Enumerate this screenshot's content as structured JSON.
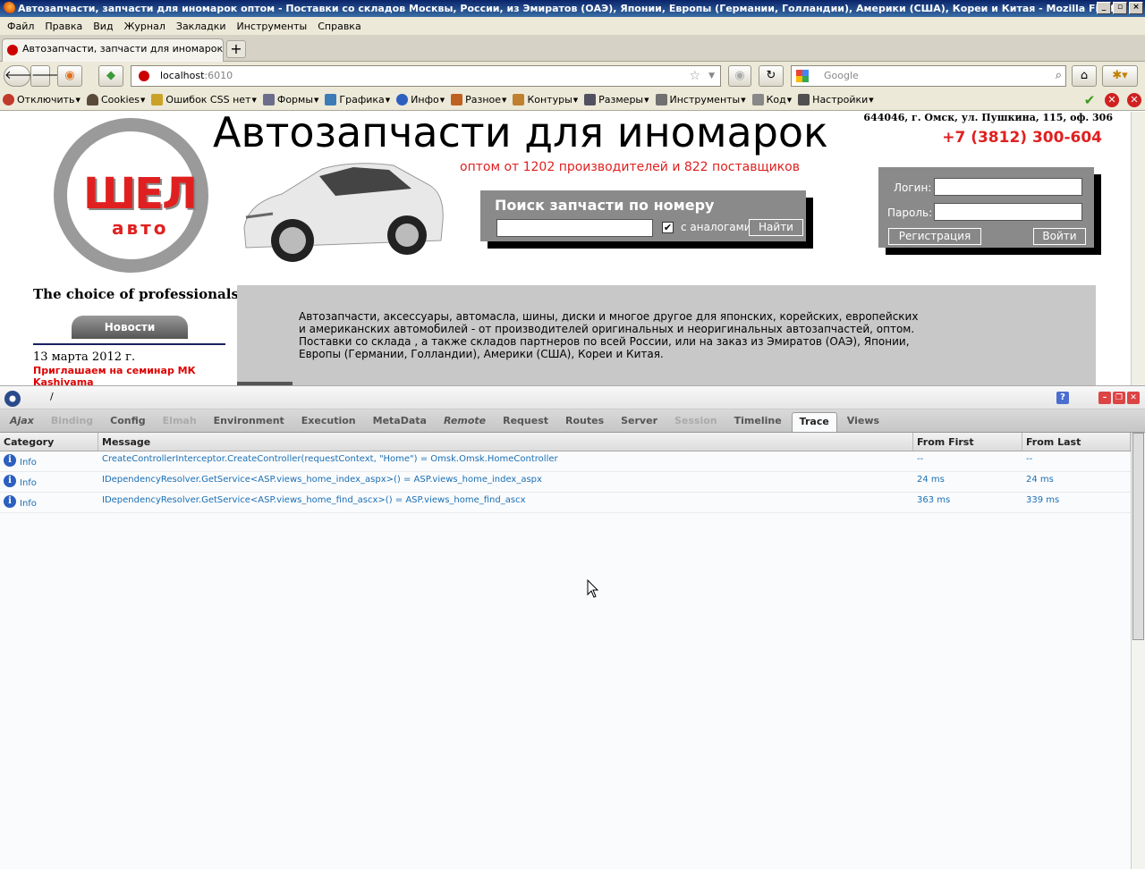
{
  "window": {
    "title": "Автозапчасти, запчасти для иномарок оптом - Поставки со складов Москвы, России, из Эмиратов (ОАЭ), Японии, Европы (Германии, Голландии), Америки (США), Кореи и Китая - Mozilla Firefox"
  },
  "menu": [
    "Файл",
    "Правка",
    "Вид",
    "Журнал",
    "Закладки",
    "Инструменты",
    "Справка"
  ],
  "tab": {
    "title": "Автозапчасти, запчасти для иномарок оп..."
  },
  "address": {
    "host": "localhost",
    "port": ":6010"
  },
  "search": {
    "placeholder": "Google"
  },
  "devtoolbar": [
    {
      "label": "Отключить",
      "icon": "disable-icon",
      "color": "#c0392b"
    },
    {
      "label": "Cookies",
      "icon": "cookies-icon",
      "color": "#5a4a3a"
    },
    {
      "label": "Ошибок CSS нет",
      "icon": "css-icon",
      "color": "#c9a227"
    },
    {
      "label": "Формы",
      "icon": "forms-icon",
      "color": "#6c6c8c"
    },
    {
      "label": "Графика",
      "icon": "images-icon",
      "color": "#3d7ab8"
    },
    {
      "label": "Инфо",
      "icon": "info-icon",
      "color": "#2c5fbf"
    },
    {
      "label": "Разное",
      "icon": "misc-icon",
      "color": "#c06020"
    },
    {
      "label": "Контуры",
      "icon": "outline-icon",
      "color": "#c08030"
    },
    {
      "label": "Размеры",
      "icon": "resize-icon",
      "color": "#505060"
    },
    {
      "label": "Инструменты",
      "icon": "tools-icon",
      "color": "#707070"
    },
    {
      "label": "Код",
      "icon": "source-icon",
      "color": "#888888"
    },
    {
      "label": "Настройки",
      "icon": "options-icon",
      "color": "#505050"
    }
  ],
  "site": {
    "headline": "Автозапчасти для иномарок",
    "subheadline": "оптом от 1202 производителей и 822 поставщиков",
    "address": "644046, г. Омск, ул. Пушкина, 115, оф. 306",
    "phone": "+7 (3812) 300-604",
    "logo_main": "ШЕЛ",
    "logo_sub": "авто",
    "search_title": "Поиск запчасти по номеру",
    "analogs_label": "с аналогами",
    "find_button": "Найти",
    "login_label": "Логин:",
    "password_label": "Пароль:",
    "register_button": "Регистрация",
    "login_button": "Войти",
    "slogan": "The choice of professionals",
    "news_button": "Новости",
    "news_date": "13 марта 2012 г.",
    "news_text": "Приглашаем на семинар МК Kashiyama",
    "intro": "Автозапчасти, аксессуары, автомасла, шины, диски и многое другое для японских, корейских, европейских и американских автомобилей - от производителей оригинальных и неоригинальных автозапчастей, оптом. Поставки со склада , а также складов партнеров по всей России, или на заказ из Эмиратов (ОАЭ), Японии, Европы (Германии, Голландии), Америки (США), Кореи и Китая."
  },
  "glimpse": {
    "path": "/",
    "tabs": [
      {
        "label": "Ajax",
        "state": "italic"
      },
      {
        "label": "Binding",
        "state": "disabled"
      },
      {
        "label": "Config",
        "state": "normal"
      },
      {
        "label": "Elmah",
        "state": "disabled"
      },
      {
        "label": "Environment",
        "state": "normal"
      },
      {
        "label": "Execution",
        "state": "normal"
      },
      {
        "label": "MetaData",
        "state": "normal"
      },
      {
        "label": "Remote",
        "state": "italic"
      },
      {
        "label": "Request",
        "state": "normal"
      },
      {
        "label": "Routes",
        "state": "normal"
      },
      {
        "label": "Server",
        "state": "normal"
      },
      {
        "label": "Session",
        "state": "disabled"
      },
      {
        "label": "Timeline",
        "state": "normal"
      },
      {
        "label": "Trace",
        "state": "active"
      },
      {
        "label": "Views",
        "state": "normal"
      }
    ],
    "columns": [
      "Category",
      "Message",
      "From First",
      "From Last"
    ],
    "rows": [
      {
        "category": "Info",
        "message": "CreateControllerInterceptor.CreateController(requestContext, \"Home\") = Omsk.Omsk.HomeController",
        "from_first": "--",
        "from_last": "--"
      },
      {
        "category": "Info",
        "message": "IDependencyResolver.GetService<ASP.views_home_index_aspx>() = ASP.views_home_index_aspx",
        "from_first": "24 ms",
        "from_last": "24 ms"
      },
      {
        "category": "Info",
        "message": "IDependencyResolver.GetService<ASP.views_home_find_ascx>() = ASP.views_home_find_ascx",
        "from_first": "363 ms",
        "from_last": "339 ms"
      }
    ]
  }
}
